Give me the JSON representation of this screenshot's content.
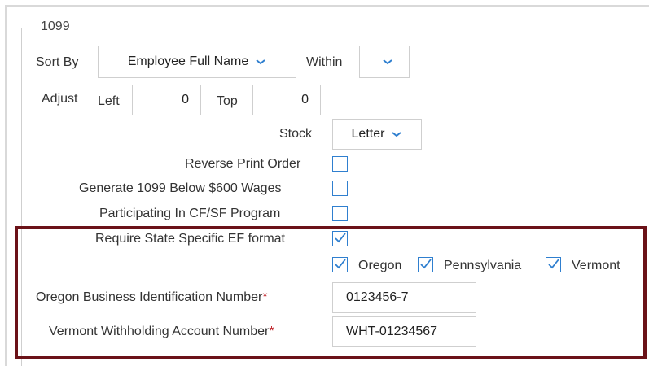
{
  "group": {
    "legend": "1099"
  },
  "sort": {
    "label": "Sort By",
    "value": "Employee Full Name",
    "within_label": "Within",
    "within_value": ""
  },
  "adjust": {
    "label": "Adjust",
    "left_label": "Left",
    "left_value": "0",
    "top_label": "Top",
    "top_value": "0"
  },
  "stock": {
    "label": "Stock",
    "value": "Letter"
  },
  "options": {
    "reverse_print": {
      "label": "Reverse Print Order",
      "checked": false
    },
    "generate_below": {
      "label": "Generate 1099 Below $600 Wages",
      "checked": false
    },
    "participating": {
      "label": "Participating In CF/SF Program",
      "checked": false
    },
    "require_state": {
      "label": "Require State Specific EF format",
      "checked": true
    }
  },
  "states": [
    {
      "label": "Oregon",
      "checked": true
    },
    {
      "label": "Pennsylvania",
      "checked": true
    },
    {
      "label": "Vermont",
      "checked": true
    }
  ],
  "oregon_bin": {
    "label": "Oregon Business Identification Number",
    "required_mark": "*",
    "value": "0123456-7"
  },
  "vermont_wan": {
    "label": "Vermont Withholding Account Number",
    "required_mark": "*",
    "value": "WHT-01234567"
  },
  "colors": {
    "accent": "#2f7fcf",
    "highlight_border": "#6b1218",
    "required": "#c0282e"
  }
}
